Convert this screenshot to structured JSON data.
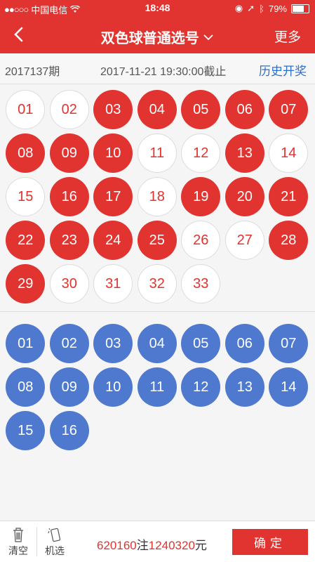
{
  "status": {
    "carrier": "中国电信",
    "time": "18:48",
    "battery": "79%",
    "battery_level": 0.79
  },
  "nav": {
    "title": "双色球普通选号",
    "more": "更多"
  },
  "info": {
    "issue": "2017137期",
    "deadline_time": "2017-11-21 19:30:00",
    "deadline_suffix": "截止",
    "history": "历史开奖"
  },
  "red_balls": [
    {
      "n": "01",
      "selected": false
    },
    {
      "n": "02",
      "selected": false
    },
    {
      "n": "03",
      "selected": true
    },
    {
      "n": "04",
      "selected": true
    },
    {
      "n": "05",
      "selected": true
    },
    {
      "n": "06",
      "selected": true
    },
    {
      "n": "07",
      "selected": true
    },
    {
      "n": "08",
      "selected": true
    },
    {
      "n": "09",
      "selected": true
    },
    {
      "n": "10",
      "selected": true
    },
    {
      "n": "11",
      "selected": false
    },
    {
      "n": "12",
      "selected": false
    },
    {
      "n": "13",
      "selected": true
    },
    {
      "n": "14",
      "selected": false
    },
    {
      "n": "15",
      "selected": false
    },
    {
      "n": "16",
      "selected": true
    },
    {
      "n": "17",
      "selected": true
    },
    {
      "n": "18",
      "selected": false
    },
    {
      "n": "19",
      "selected": true
    },
    {
      "n": "20",
      "selected": true
    },
    {
      "n": "21",
      "selected": true
    },
    {
      "n": "22",
      "selected": true
    },
    {
      "n": "23",
      "selected": true
    },
    {
      "n": "24",
      "selected": true
    },
    {
      "n": "25",
      "selected": true
    },
    {
      "n": "26",
      "selected": false
    },
    {
      "n": "27",
      "selected": false
    },
    {
      "n": "28",
      "selected": true
    },
    {
      "n": "29",
      "selected": true
    },
    {
      "n": "30",
      "selected": false
    },
    {
      "n": "31",
      "selected": false
    },
    {
      "n": "32",
      "selected": false
    },
    {
      "n": "33",
      "selected": false
    }
  ],
  "blue_balls": [
    {
      "n": "01",
      "selected": true
    },
    {
      "n": "02",
      "selected": true
    },
    {
      "n": "03",
      "selected": true
    },
    {
      "n": "04",
      "selected": true
    },
    {
      "n": "05",
      "selected": true
    },
    {
      "n": "06",
      "selected": true
    },
    {
      "n": "07",
      "selected": true
    },
    {
      "n": "08",
      "selected": true
    },
    {
      "n": "09",
      "selected": true
    },
    {
      "n": "10",
      "selected": true
    },
    {
      "n": "11",
      "selected": true
    },
    {
      "n": "12",
      "selected": true
    },
    {
      "n": "13",
      "selected": true
    },
    {
      "n": "14",
      "selected": true
    },
    {
      "n": "15",
      "selected": true
    },
    {
      "n": "16",
      "selected": true
    }
  ],
  "bottom": {
    "clear": "清空",
    "random": "机选",
    "bets": "620160",
    "bets_unit": "注",
    "amount": "1240320",
    "amount_unit": "元",
    "confirm": "确定"
  },
  "colors": {
    "red": "#e1332f",
    "blue": "#4e79cf",
    "link": "#2d6fce"
  }
}
